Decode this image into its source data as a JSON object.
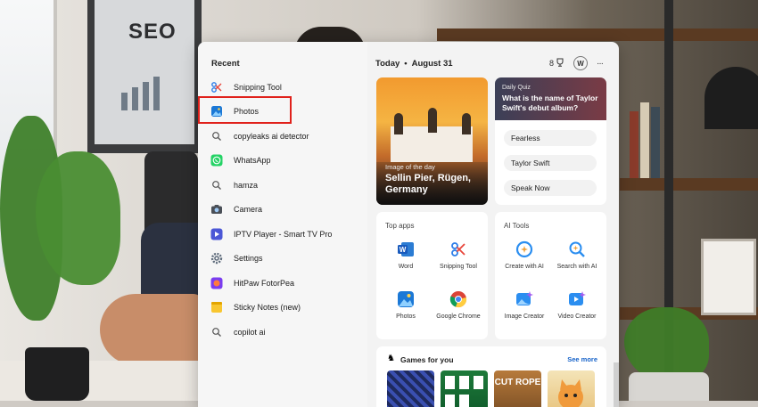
{
  "background": {
    "poster_text": "SEO"
  },
  "recent": {
    "title": "Recent",
    "items": [
      {
        "label": "Snipping Tool",
        "icon": "snipping-tool-icon"
      },
      {
        "label": "Photos",
        "icon": "photos-icon"
      },
      {
        "label": "copyleaks ai detector",
        "icon": "search-icon"
      },
      {
        "label": "WhatsApp",
        "icon": "whatsapp-icon"
      },
      {
        "label": "hamza",
        "icon": "search-icon"
      },
      {
        "label": "Camera",
        "icon": "camera-icon"
      },
      {
        "label": "IPTV Player - Smart TV Pro",
        "icon": "iptv-icon"
      },
      {
        "label": "Settings",
        "icon": "gear-icon"
      },
      {
        "label": "HitPaw FotorPea",
        "icon": "hitpaw-icon"
      },
      {
        "label": "Sticky Notes (new)",
        "icon": "sticky-notes-icon"
      },
      {
        "label": "copilot ai",
        "icon": "search-icon"
      }
    ]
  },
  "today": {
    "label": "Today",
    "date": "August 31",
    "rewards_points": "8",
    "avatar_letter": "W",
    "more": "···"
  },
  "image_of_day": {
    "caption": "Image of the day",
    "title": "Sellin Pier, Rügen, Germany"
  },
  "quiz": {
    "label": "Daily Quiz",
    "question": "What is the name of Taylor Swift's debut album?",
    "options": [
      "Fearless",
      "Taylor Swift",
      "Speak Now"
    ]
  },
  "top_apps": {
    "title": "Top apps",
    "apps": [
      {
        "label": "Word",
        "icon": "word-icon"
      },
      {
        "label": "Snipping Tool",
        "icon": "snipping-tool-icon"
      },
      {
        "label": "Photos",
        "icon": "photos-icon"
      },
      {
        "label": "Google Chrome",
        "icon": "chrome-icon"
      }
    ]
  },
  "ai_tools": {
    "title": "AI Tools",
    "tools": [
      {
        "label": "Create with AI",
        "icon": "create-ai-icon"
      },
      {
        "label": "Search with AI",
        "icon": "search-ai-icon"
      },
      {
        "label": "Image Creator",
        "icon": "image-creator-icon"
      },
      {
        "label": "Video Creator",
        "icon": "video-creator-icon"
      }
    ]
  },
  "games": {
    "title": "Games for you",
    "see_more": "See more",
    "game_art_text": [
      "CUT ROPE"
    ]
  },
  "colors": {
    "highlight": "#e0211b",
    "accent_link": "#1763c9",
    "panel_bg": "#f3f3f3"
  }
}
